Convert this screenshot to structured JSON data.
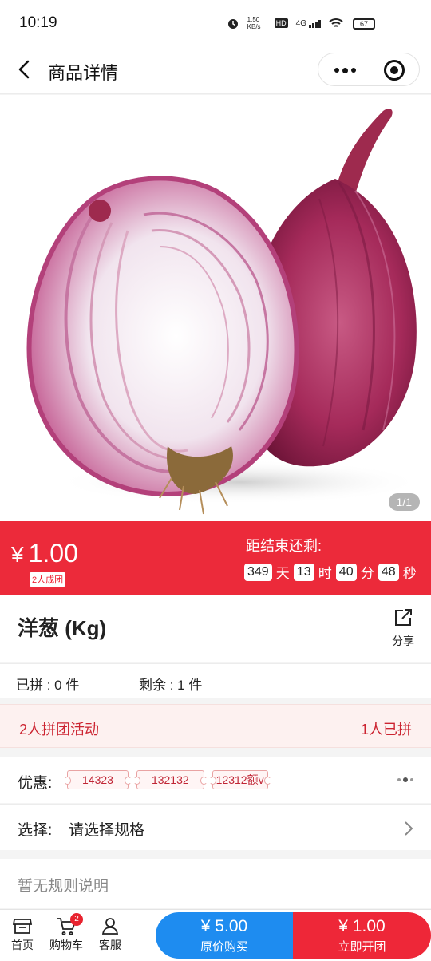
{
  "status_bar": {
    "time": "10:19",
    "net_speed": "1.50 KB/s",
    "hd": "HD",
    "signal": "4G",
    "battery": "67"
  },
  "navbar": {
    "title": "商品详情",
    "icons": [
      "back-arrow-icon",
      "more-dots-icon",
      "close-target-icon"
    ]
  },
  "gallery": {
    "counter": "1/1",
    "image_subject": "red onions"
  },
  "promo": {
    "price": "1.00",
    "currency": "¥",
    "group_tag": "2人成团",
    "countdown_label": "距结束还剩:",
    "days": "349",
    "days_unit": "天",
    "hours": "13",
    "hours_unit": "时",
    "minutes": "40",
    "minutes_unit": "分",
    "seconds": "48",
    "seconds_unit": "秒"
  },
  "product": {
    "name": "洋葱 (Kg)",
    "share_label": "分享"
  },
  "stock": {
    "joined": "已拼 : 0 件",
    "remaining": "剩余 : 1 件"
  },
  "activity": {
    "title": "2人拼团活动",
    "status": "1人已拼"
  },
  "coupons": {
    "label": "优惠:",
    "items": [
      "14323",
      "132132",
      "12312额v"
    ]
  },
  "spec": {
    "label": "选择:",
    "value": "请选择规格"
  },
  "rules": {
    "text": "暂无规则说明"
  },
  "bottom_bar": {
    "home": "首页",
    "cart": "购物车",
    "cart_badge": "2",
    "service": "客服",
    "original_price": "¥ 5.00",
    "original_label": "原价购买",
    "group_price": "¥ 1.00",
    "group_label": "立即开团"
  },
  "colors": {
    "promo_red": "#ec2a3a",
    "original_blue": "#1e8cf0",
    "activity_bg": "#fdf1f0",
    "activity_text": "#cc2431"
  }
}
